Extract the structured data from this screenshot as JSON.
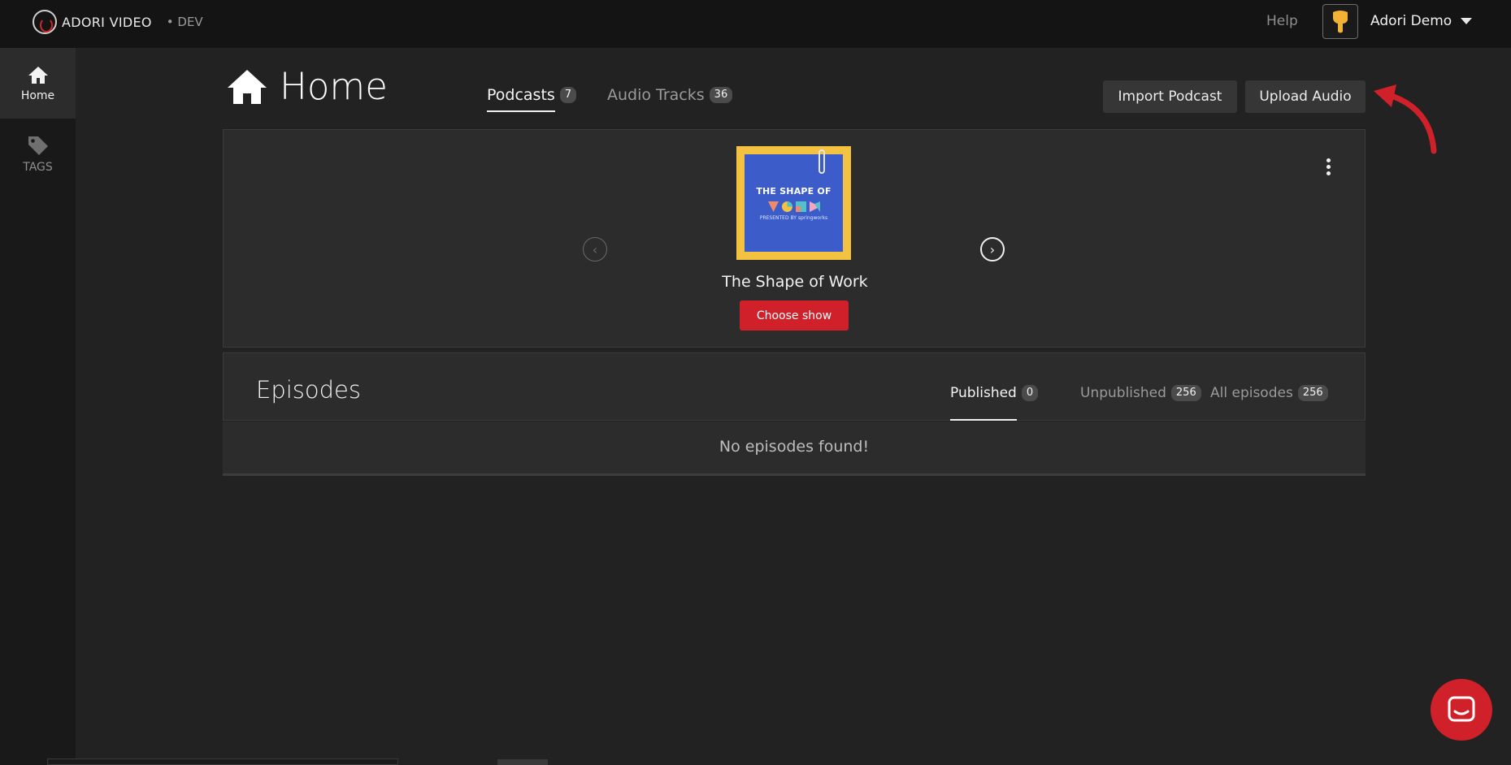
{
  "brand": {
    "name": "ADORI VIDEO",
    "env": "• DEV"
  },
  "topbar": {
    "help": "Help",
    "user_name": "Adori Demo"
  },
  "sidebar": {
    "items": [
      {
        "label": "Home",
        "icon": "home-icon",
        "active": true
      },
      {
        "label": "TAGS",
        "icon": "tag-icon",
        "active": false
      }
    ]
  },
  "header": {
    "title": "Home",
    "tabs": [
      {
        "label": "Podcasts",
        "count": "7",
        "active": true
      },
      {
        "label": "Audio Tracks",
        "count": "36",
        "active": false
      }
    ],
    "import_label": "Import Podcast",
    "upload_label": "Upload Audio"
  },
  "podcast": {
    "name": "The Shape of Work",
    "choose_label": "Choose show",
    "cover_title": "THE SHAPE OF",
    "cover_sub": "PRESENTED BY springworks"
  },
  "episodes": {
    "title": "Episodes",
    "tabs": [
      {
        "label": "Published",
        "count": "0",
        "active": true
      },
      {
        "label": "Unpublished",
        "count": "256",
        "active": false
      },
      {
        "label": "All episodes",
        "count": "256",
        "active": false
      }
    ],
    "empty": "No episodes found!"
  },
  "colors": {
    "accent": "#d0202a",
    "background": "#222222",
    "card": "#2c2c2c"
  }
}
